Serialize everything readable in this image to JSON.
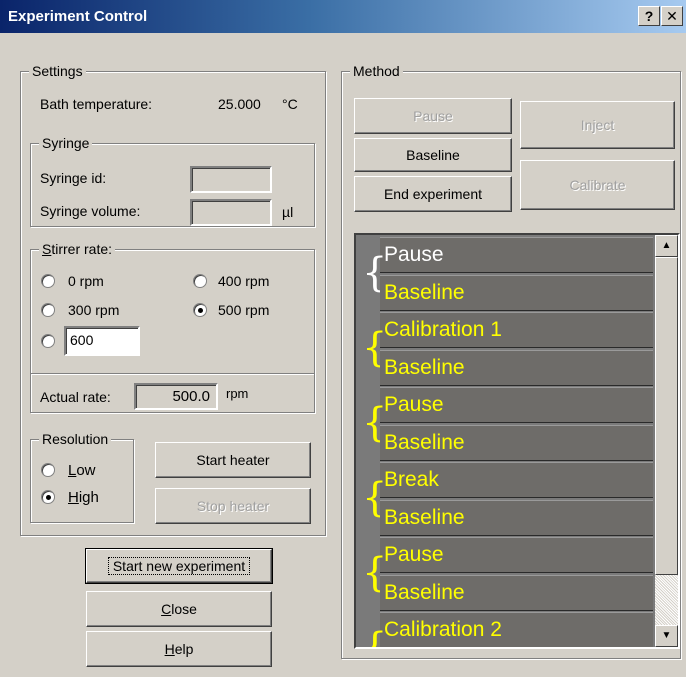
{
  "window": {
    "title": "Experiment Control",
    "help_button": "?",
    "close_button": "✕"
  },
  "settings": {
    "legend": "Settings",
    "bath_temperature_label": "Bath temperature:",
    "bath_temperature_value": "25.000",
    "bath_temperature_unit": "°C",
    "syringe": {
      "legend": "Syringe",
      "id_label": "Syringe id:",
      "id_value": "",
      "volume_label": "Syringe volume:",
      "volume_value": "",
      "volume_unit": "µl"
    },
    "stirrer": {
      "legend_first": "S",
      "legend_rest": "tirrer rate:",
      "options": [
        "0 rpm",
        "300 rpm",
        "400 rpm",
        "500 rpm"
      ],
      "selected": "500 rpm",
      "custom_value": "600",
      "actual_rate_label": "Actual rate:",
      "actual_rate_value": "500.0",
      "actual_rate_unit": "rpm"
    },
    "resolution": {
      "legend": "Resolution",
      "low_first": "L",
      "low_rest": "ow",
      "high_first": "H",
      "high_rest": "igh",
      "selected": "High"
    },
    "start_heater": "Start heater",
    "stop_heater": "Stop heater"
  },
  "buttons": {
    "start_new_experiment": "Start new experiment",
    "close_first": "C",
    "close_rest": "lose",
    "help_first": "H",
    "help_rest": "elp"
  },
  "method": {
    "legend": "Method",
    "pause": "Pause",
    "inject": "Inject",
    "baseline": "Baseline",
    "end_experiment": "End experiment",
    "calibrate": "Calibrate",
    "steps": [
      {
        "label": "Pause",
        "color": "#ffffff"
      },
      {
        "label": "Baseline",
        "color": "#ffff00"
      },
      {
        "label": "Calibration 1",
        "color": "#ffff00"
      },
      {
        "label": "Baseline",
        "color": "#ffff00"
      },
      {
        "label": "Pause",
        "color": "#ffff00"
      },
      {
        "label": "Baseline",
        "color": "#ffff00"
      },
      {
        "label": "Break",
        "color": "#ffff00"
      },
      {
        "label": "Baseline",
        "color": "#ffff00"
      },
      {
        "label": "Pause",
        "color": "#ffff00"
      },
      {
        "label": "Baseline",
        "color": "#ffff00"
      },
      {
        "label": "Calibration 2",
        "color": "#ffff00"
      }
    ],
    "scroll_up": "▲",
    "scroll_down": "▼"
  }
}
